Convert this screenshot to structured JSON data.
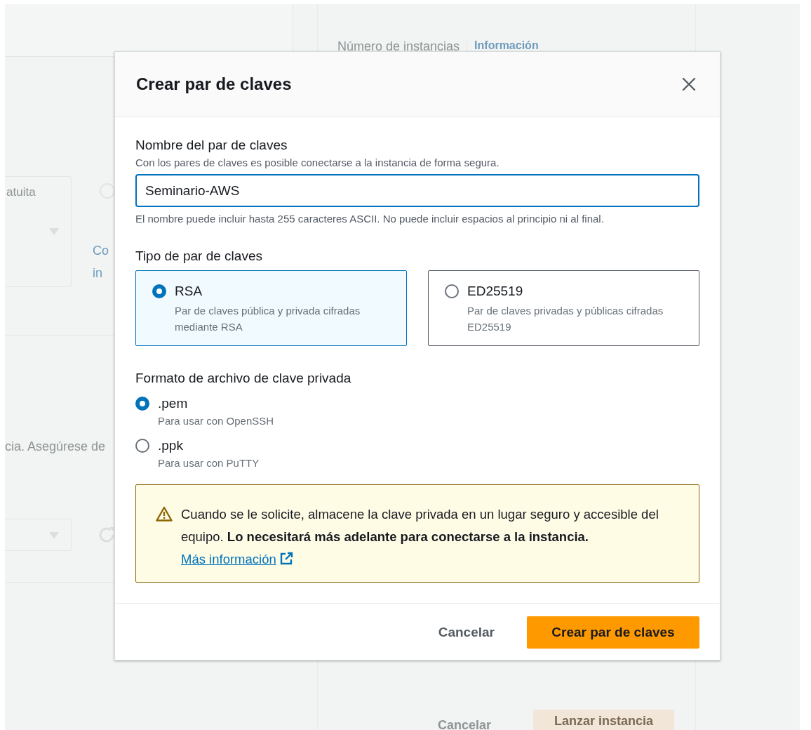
{
  "background": {
    "count_label": "Número de instancias",
    "count_info": "Información",
    "select_value": "atuita",
    "radio_selected": false,
    "link_lines": [
      "Co",
      "in"
    ],
    "note": "cia. Asegúrese de",
    "cancel": "Cancelar",
    "launch": "Lanzar instancia"
  },
  "modal": {
    "title": "Crear par de claves",
    "name_field": {
      "label": "Nombre del par de claves",
      "description": "Con los pares de claves es posible conectarse a la instancia de forma segura.",
      "value": "Seminario-AWS",
      "hint": "El nombre puede incluir hasta 255 caracteres ASCII. No puede incluir espacios al principio ni al final."
    },
    "key_type": {
      "label": "Tipo de par de claves",
      "options": [
        {
          "label": "RSA",
          "description": "Par de claves pública y privada cifradas mediante RSA",
          "selected": true
        },
        {
          "label": "ED25519",
          "description": "Par de claves privadas y públicas cifradas ED25519",
          "selected": false
        }
      ]
    },
    "file_format": {
      "label": "Formato de archivo de clave privada",
      "options": [
        {
          "label": ".pem",
          "description": "Para usar con OpenSSH",
          "selected": true
        },
        {
          "label": ".ppk",
          "description": "Para usar con PuTTY",
          "selected": false
        }
      ]
    },
    "alert": {
      "text": "Cuando se le solicite, almacene la clave privada en un lugar seguro y accesible del equipo. **Lo necesitará más adelante para conectarse a la instancia.**",
      "link": "Más información"
    },
    "buttons": [
      {
        "label": "Cancelar",
        "kind": "link"
      },
      {
        "label": "Crear par de claves",
        "kind": "primary"
      }
    ]
  }
}
